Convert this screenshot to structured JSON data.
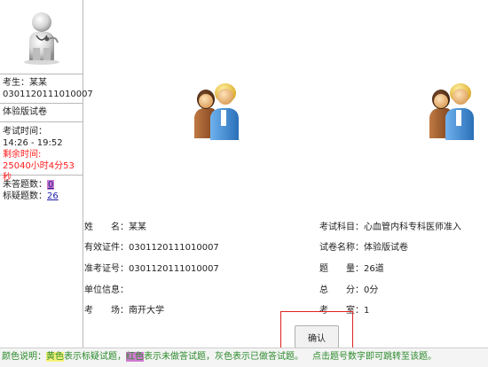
{
  "candidate": {
    "label": "考生：某某",
    "number": "0301120111010007"
  },
  "paper_label": "体验版试卷",
  "time": {
    "label": "考试时间：",
    "range": "14:26 - 19:52",
    "remaining_label": "剩余时间:",
    "remaining_value": "25040小时4分53秒"
  },
  "counts": {
    "unanswered_label": "未答题数：",
    "unanswered_value": "0",
    "flagged_label": "标疑题数：",
    "flagged_value": "26"
  },
  "info_left": {
    "name": "姓　　名：某某",
    "id_card": "有效证件：0301120111010007",
    "admission": "准考证号：0301120111010007",
    "unit": "单位信息：",
    "site": "考　　场：南开大学"
  },
  "info_right": {
    "subject": "考试科目：心血管内科专科医师准入",
    "paper_name": "试卷名称：体验版试卷",
    "questions": "题　　量：26道",
    "total": "总　　分：0分",
    "room": "考　　室：1"
  },
  "confirm_label": "确认",
  "legend": {
    "prefix": "颜色说明：",
    "yellow": "黄色",
    "yellow_desc": "表示标疑试题，",
    "red": "红色",
    "red_desc": "表示未做答试题，",
    "gray": "灰色",
    "gray_desc": "表示已做答试题。",
    "jump": "点击题号数字即可跳转至该题。"
  },
  "colors": {
    "remaining_red": "#ff1a1a",
    "highlight_purple": "#d07ad0",
    "highlight_yellow": "#f6f27a",
    "legend_green": "#2b8a2b",
    "confirm_box_red": "#e02020"
  },
  "icons": {
    "avatar": "doctor-avatar-icon",
    "people": "two-people-icon"
  }
}
